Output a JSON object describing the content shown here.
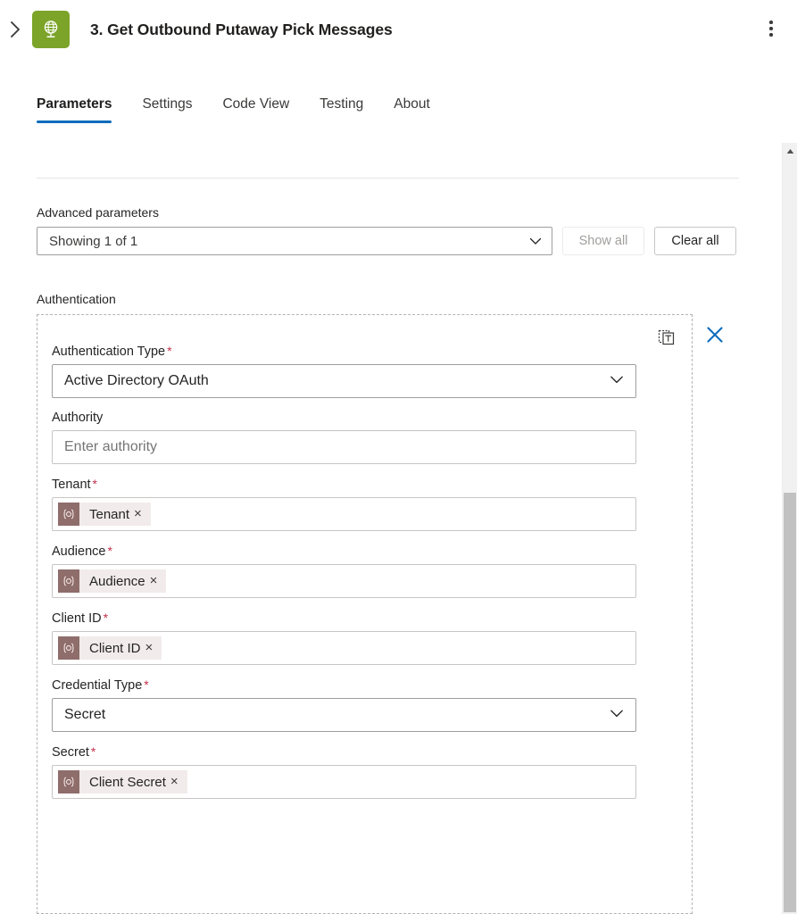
{
  "header": {
    "expand_icon": "chevron-right-icon",
    "node_icon": "globe-http-icon",
    "node_icon_color": "#7ca429",
    "title": "3. Get Outbound Putaway Pick Messages",
    "more_menu_icon": "more-vertical-icon"
  },
  "tabs": {
    "active": "Parameters",
    "accent_color": "#0f6cbd",
    "items": [
      {
        "label": "Parameters"
      },
      {
        "label": "Settings"
      },
      {
        "label": "Code View"
      },
      {
        "label": "Testing"
      },
      {
        "label": "About"
      }
    ]
  },
  "advanced_parameters": {
    "label": "Advanced parameters",
    "select_value": "Showing 1 of 1",
    "chevron_icon": "chevron-down-icon",
    "show_all_label": "Show all",
    "show_all_disabled": true,
    "clear_all_label": "Clear all"
  },
  "authentication": {
    "section_label": "Authentication",
    "edit_icon": "switch-to-text-mode-icon",
    "close_icon": "close-icon",
    "close_icon_color": "#0f6cbd",
    "required_marker": "*",
    "required_color": "#c4314b",
    "token_icon": "parameter-token-icon",
    "token_icon_color": "#8e6d6b",
    "token_remove_label": "×",
    "fields": [
      {
        "name": "authentication-type",
        "label": "Authentication Type",
        "required": true,
        "kind": "select",
        "value": "Active Directory OAuth"
      },
      {
        "name": "authority",
        "label": "Authority",
        "required": false,
        "kind": "input",
        "value": "",
        "placeholder": "Enter authority"
      },
      {
        "name": "tenant",
        "label": "Tenant",
        "required": true,
        "kind": "token",
        "token_label": "Tenant"
      },
      {
        "name": "audience",
        "label": "Audience",
        "required": true,
        "kind": "token",
        "token_label": "Audience"
      },
      {
        "name": "client-id",
        "label": "Client ID",
        "required": true,
        "kind": "token",
        "token_label": "Client ID"
      },
      {
        "name": "credential-type",
        "label": "Credential Type",
        "required": true,
        "kind": "select",
        "value": "Secret"
      },
      {
        "name": "secret",
        "label": "Secret",
        "required": true,
        "kind": "token",
        "token_label": "Client Secret"
      }
    ]
  },
  "scrollbar": {
    "up_arrow_icon": "scroll-up-arrow-icon",
    "thumb": "scroll-thumb"
  }
}
